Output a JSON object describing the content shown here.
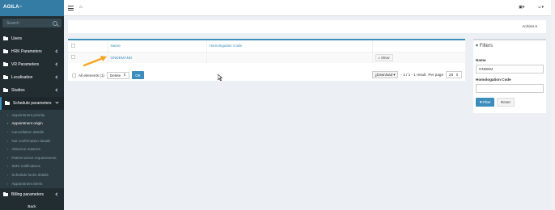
{
  "app": {
    "logo_text": "AGILA",
    "logo_sup": "™"
  },
  "sidebar": {
    "search_placeholder": "Search",
    "items": [
      {
        "label": "Users"
      },
      {
        "label": "HRK Parameters"
      },
      {
        "label": "VR Parameters"
      },
      {
        "label": "Localisation"
      },
      {
        "label": "Studies"
      },
      {
        "label": "Schedule parameters"
      },
      {
        "label": "Billing parameters"
      }
    ],
    "submenu": [
      {
        "label": "Appointment priority"
      },
      {
        "label": "Appointment origin"
      },
      {
        "label": "Cancellation details"
      },
      {
        "label": "Not confirmation details"
      },
      {
        "label": "Absence reasons"
      },
      {
        "label": "Patient arrive requirements"
      },
      {
        "label": "SMS notifications"
      },
      {
        "label": "Schedule locks details"
      },
      {
        "label": "Appointment items"
      }
    ],
    "back_label": "Back"
  },
  "topbar": {
    "home_glyph": "⌂",
    "user_menu": "▾",
    "settings_menu": "▾"
  },
  "actions": {
    "label": "Actions ▾"
  },
  "table": {
    "headers": {
      "name": "Name",
      "homologation": "Homologation Code"
    },
    "rows": [
      {
        "name": "ONDEMAND",
        "homologation": "",
        "action": "Show"
      }
    ]
  },
  "footer": {
    "all_elements": "All elements (1)",
    "batch_action": "Delete",
    "ok": "OK",
    "download": "Download ▾",
    "pagination": "- 1 / 1 - 1 result",
    "per_page_label": "Per page",
    "per_page_value": "25"
  },
  "filters": {
    "title": "Filters",
    "name_label": "Name",
    "name_value": "ONDEM",
    "homologation_label": "Homologation Code",
    "homologation_value": "",
    "filter_button": "Filter",
    "reset_button": "Reset"
  },
  "colors": {
    "sidebar": "#222d32",
    "accent": "#3c8dbc",
    "arrow": "#f5a623"
  }
}
